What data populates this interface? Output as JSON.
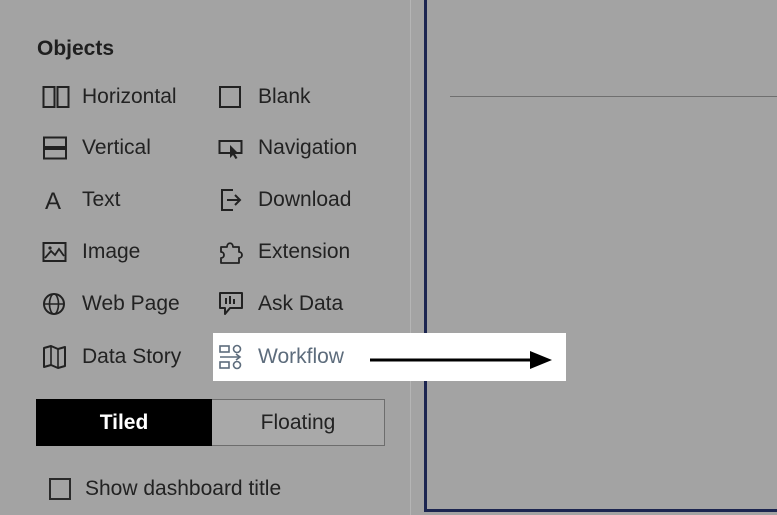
{
  "objects_panel": {
    "title": "Objects",
    "items": [
      {
        "label": "Horizontal",
        "icon": "horizontal-icon"
      },
      {
        "label": "Blank",
        "icon": "blank-icon"
      },
      {
        "label": "Vertical",
        "icon": "vertical-icon"
      },
      {
        "label": "Navigation",
        "icon": "navigation-icon"
      },
      {
        "label": "Text",
        "icon": "text-icon"
      },
      {
        "label": "Download",
        "icon": "download-icon"
      },
      {
        "label": "Image",
        "icon": "image-icon"
      },
      {
        "label": "Extension",
        "icon": "extension-icon"
      },
      {
        "label": "Web Page",
        "icon": "web-page-icon"
      },
      {
        "label": "Ask Data",
        "icon": "ask-data-icon"
      },
      {
        "label": "Data Story",
        "icon": "data-story-icon"
      },
      {
        "label": "Workflow",
        "icon": "workflow-icon"
      }
    ]
  },
  "layout_toggle": {
    "tiled": "Tiled",
    "floating": "Floating",
    "selected": "Tiled"
  },
  "show_title": {
    "label": "Show dashboard title",
    "checked": false
  },
  "colors": {
    "panel_bg": "#a3a3a3",
    "canvas_border": "#1c2550",
    "highlight": "#ffffff",
    "workflow_text": "#5d6c7c"
  }
}
